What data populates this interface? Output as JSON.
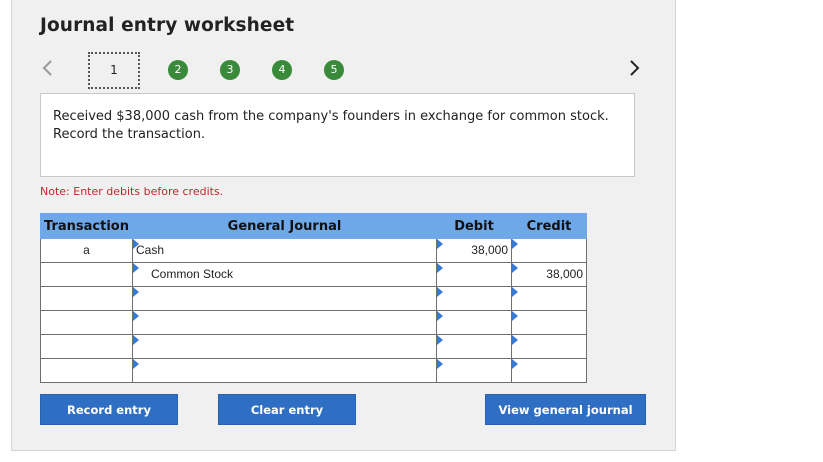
{
  "title": "Journal entry worksheet",
  "steps": [
    "1",
    "2",
    "3",
    "4",
    "5"
  ],
  "description": "Received $38,000 cash from the company's founders in exchange for common stock. Record the transaction.",
  "note": "Note: Enter debits before credits.",
  "table": {
    "headers": {
      "transaction": "Transaction",
      "journal": "General Journal",
      "debit": "Debit",
      "credit": "Credit"
    },
    "rows": [
      {
        "transaction": "a",
        "account": "Cash",
        "debit": "38,000",
        "credit": ""
      },
      {
        "transaction": "",
        "account": "Common Stock",
        "debit": "",
        "credit": "38,000"
      },
      {
        "transaction": "",
        "account": "",
        "debit": "",
        "credit": ""
      },
      {
        "transaction": "",
        "account": "",
        "debit": "",
        "credit": ""
      },
      {
        "transaction": "",
        "account": "",
        "debit": "",
        "credit": ""
      },
      {
        "transaction": "",
        "account": "",
        "debit": "",
        "credit": ""
      }
    ]
  },
  "buttons": {
    "record": "Record entry",
    "clear": "Clear entry",
    "view": "View general journal"
  },
  "colors": {
    "step_green": "#3a8a3c",
    "header_blue": "#6fa8e8",
    "button_blue": "#2e6fc4",
    "note_red": "#c2272d"
  }
}
